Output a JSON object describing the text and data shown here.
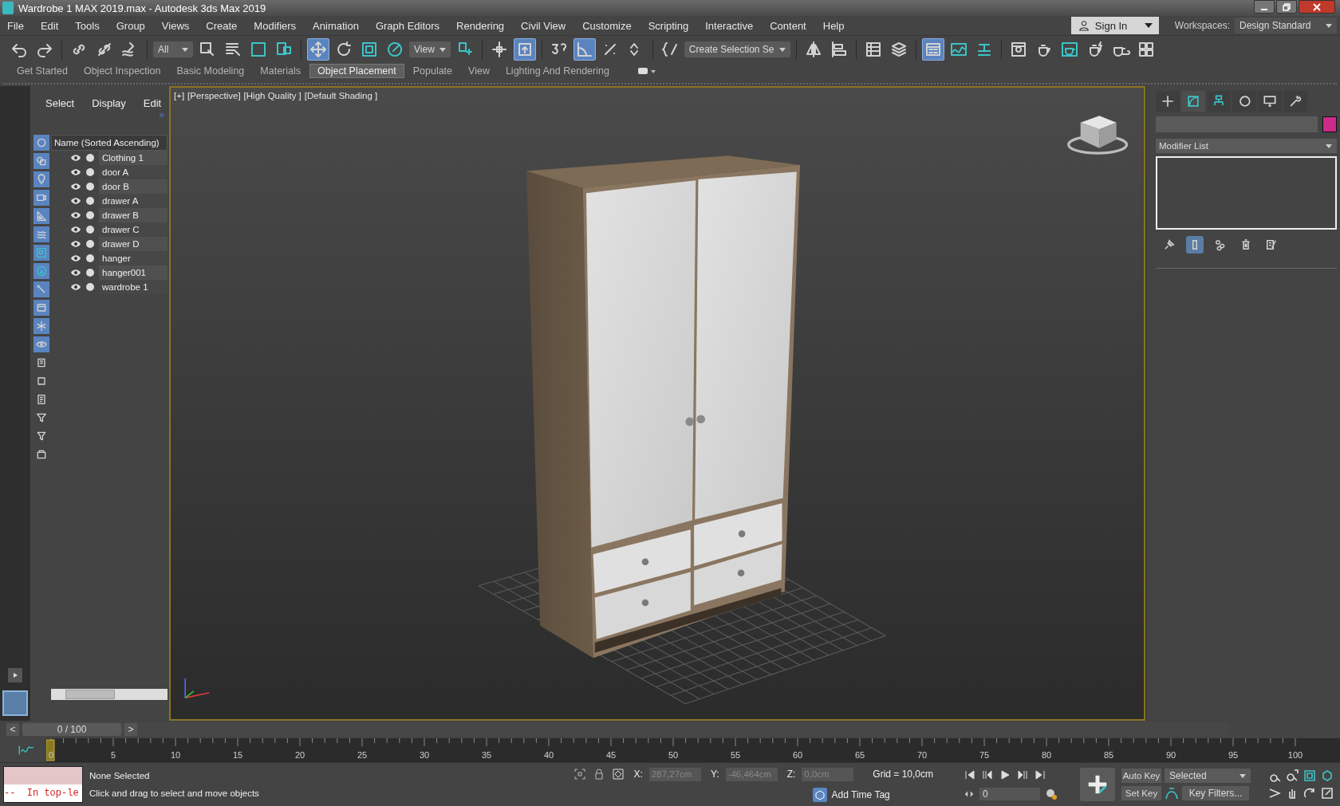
{
  "window": {
    "title": "Wardrobe 1 MAX 2019.max - Autodesk 3ds Max 2019"
  },
  "menu": [
    "File",
    "Edit",
    "Tools",
    "Group",
    "Views",
    "Create",
    "Modifiers",
    "Animation",
    "Graph Editors",
    "Rendering",
    "Civil View",
    "Customize",
    "Scripting",
    "Interactive",
    "Content",
    "Help"
  ],
  "account": {
    "label": "Sign In"
  },
  "workspaces": {
    "label": "Workspaces:",
    "value": "Design Standard"
  },
  "toolbar": [
    {
      "kind": "undo",
      "on": false
    },
    {
      "kind": "redo",
      "on": false
    },
    {
      "kind": "sep"
    },
    {
      "kind": "link",
      "on": false
    },
    {
      "kind": "unlink",
      "on": false
    },
    {
      "kind": "bind",
      "on": false
    },
    {
      "kind": "sep"
    },
    {
      "kind": "dropdown",
      "value": "All"
    },
    {
      "kind": "select",
      "on": false
    },
    {
      "kind": "selectname",
      "on": false
    },
    {
      "kind": "rect",
      "on": false
    },
    {
      "kind": "window",
      "on": false
    },
    {
      "kind": "sep"
    },
    {
      "kind": "move",
      "on": true
    },
    {
      "kind": "rotate",
      "on": false
    },
    {
      "kind": "scale",
      "on": false
    },
    {
      "kind": "place",
      "on": false
    },
    {
      "kind": "dropdown",
      "value": "View"
    },
    {
      "kind": "pivot",
      "on": false
    },
    {
      "kind": "sep"
    },
    {
      "kind": "manipulate",
      "on": false
    },
    {
      "kind": "keyboard",
      "on": true
    },
    {
      "kind": "sep"
    },
    {
      "kind": "snap",
      "on": false
    },
    {
      "kind": "anglesnap",
      "on": true
    },
    {
      "kind": "percent",
      "on": false
    },
    {
      "kind": "spinner",
      "on": false
    },
    {
      "kind": "sep"
    },
    {
      "kind": "namedsel",
      "on": false
    },
    {
      "kind": "dropdown",
      "value": "Create Selection Se"
    },
    {
      "kind": "sep"
    },
    {
      "kind": "mirror",
      "on": false
    },
    {
      "kind": "align",
      "on": false
    },
    {
      "kind": "sep"
    },
    {
      "kind": "explorer",
      "on": false
    },
    {
      "kind": "layer",
      "on": false
    },
    {
      "kind": "sep"
    },
    {
      "kind": "ribbon",
      "on": true
    },
    {
      "kind": "curve",
      "on": false
    },
    {
      "kind": "schematic",
      "on": false
    },
    {
      "kind": "sep"
    },
    {
      "kind": "material",
      "on": false
    },
    {
      "kind": "rendersetup",
      "on": false
    },
    {
      "kind": "renderframe",
      "on": false
    },
    {
      "kind": "render",
      "on": false
    },
    {
      "kind": "cloud",
      "on": false
    },
    {
      "kind": "gallery",
      "on": false
    }
  ],
  "ribbon_tabs": [
    {
      "label": "Get Started",
      "selected": false
    },
    {
      "label": "Object Inspection",
      "selected": false
    },
    {
      "label": "Basic Modeling",
      "selected": false
    },
    {
      "label": "Materials",
      "selected": false
    },
    {
      "label": "Object Placement",
      "selected": true
    },
    {
      "label": "Populate",
      "selected": false
    },
    {
      "label": "View",
      "selected": false
    },
    {
      "label": "Lighting And Rendering",
      "selected": false
    }
  ],
  "explorer": {
    "tabs": [
      "Select",
      "Display",
      "Edit"
    ],
    "more": "»",
    "filters": [
      {
        "kind": "geometry",
        "on": true
      },
      {
        "kind": "shapes",
        "on": true
      },
      {
        "kind": "lights",
        "on": true
      },
      {
        "kind": "cameras",
        "on": true
      },
      {
        "kind": "helpers",
        "on": true
      },
      {
        "kind": "spacewarps",
        "on": true
      },
      {
        "kind": "groups",
        "on": true
      },
      {
        "kind": "xrefs",
        "on": true
      },
      {
        "kind": "bones",
        "on": true
      },
      {
        "kind": "containers",
        "on": true
      },
      {
        "kind": "frozen",
        "on": true
      },
      {
        "kind": "hidden",
        "on": true
      },
      {
        "kind": "children",
        "on": false
      },
      {
        "kind": "influences",
        "on": false
      },
      {
        "kind": "dependencies",
        "on": false
      },
      {
        "kind": "selected",
        "on": false
      },
      {
        "kind": "funnel",
        "on": false
      },
      {
        "kind": "layers",
        "on": false
      }
    ],
    "column": "Name (Sorted Ascending)",
    "items": [
      {
        "name": "Clothing 1"
      },
      {
        "name": "door A"
      },
      {
        "name": "door B"
      },
      {
        "name": "drawer A"
      },
      {
        "name": "drawer B"
      },
      {
        "name": "drawer C"
      },
      {
        "name": "drawer D"
      },
      {
        "name": "hanger"
      },
      {
        "name": "hanger001"
      },
      {
        "name": "wardrobe 1"
      }
    ]
  },
  "viewport": {
    "labels": [
      "[+]",
      "[Perspective]",
      "[High Quality ]",
      "[Default Shading ]"
    ]
  },
  "command_panel": {
    "tabs": [
      {
        "kind": "create",
        "selected": false
      },
      {
        "kind": "modify",
        "selected": true
      },
      {
        "kind": "hierarchy",
        "selected": false
      },
      {
        "kind": "motion",
        "selected": false
      },
      {
        "kind": "display",
        "selected": false
      },
      {
        "kind": "utilities",
        "selected": false
      }
    ],
    "modifier_list": "Modifier List",
    "stack_tools": [
      {
        "kind": "pin",
        "on": false
      },
      {
        "kind": "result",
        "on": true
      },
      {
        "kind": "unique",
        "on": false
      },
      {
        "kind": "remove",
        "on": false
      },
      {
        "kind": "configure",
        "on": false
      }
    ]
  },
  "time_slider": {
    "prev": "<",
    "label": "0 / 100",
    "next": ">",
    "level": 0
  },
  "trackbar": {
    "ticks": [
      "0",
      "5",
      "10",
      "15",
      "20",
      "25",
      "30",
      "35",
      "40",
      "45",
      "50",
      "55",
      "60",
      "65",
      "70",
      "75",
      "80",
      "85",
      "90",
      "95",
      "100"
    ]
  },
  "status": {
    "listener": "--  In top-le",
    "selection": "None Selected",
    "prompt": "Click and drag to select and move objects",
    "x_label": "X:",
    "x": "287,27cm",
    "y_label": "Y:",
    "y": "-46,464cm",
    "z_label": "Z:",
    "z": "0,0cm",
    "grid": "Grid = 10,0cm",
    "time_tag": "Add Time Tag",
    "frame": "0",
    "auto_key": "Auto Key",
    "set_key": "Set Key",
    "key_mode": "Selected",
    "key_filters": "Key Filters..."
  }
}
